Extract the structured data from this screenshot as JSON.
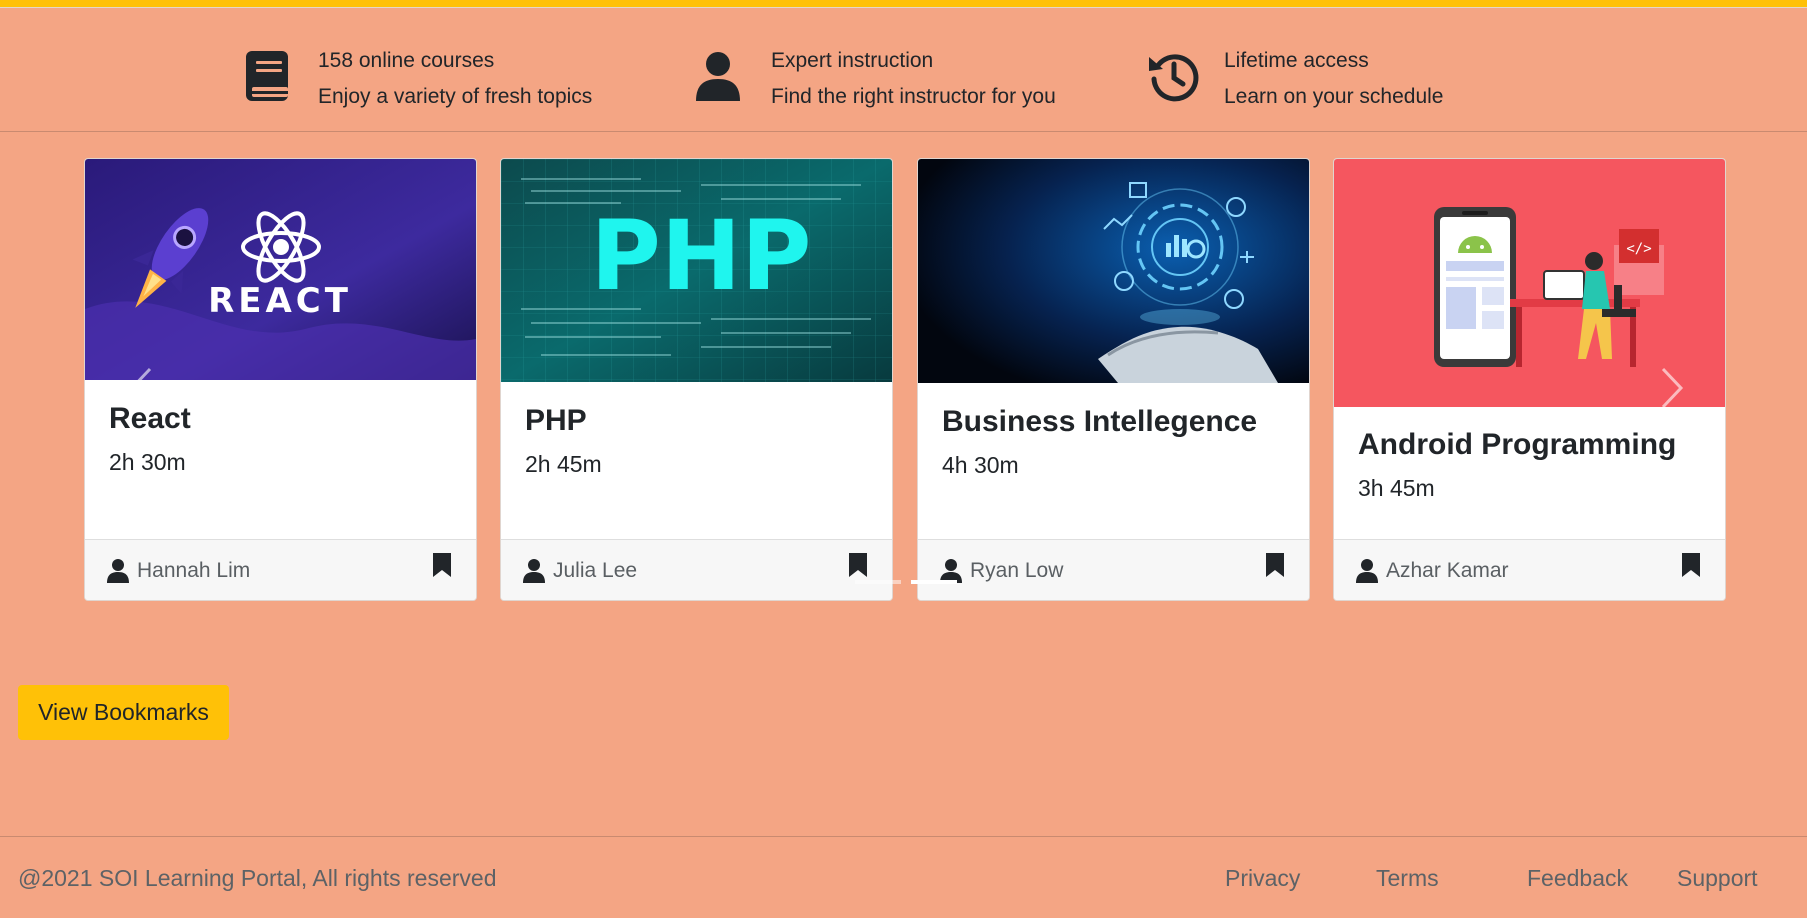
{
  "features": [
    {
      "icon": "book-icon",
      "title": "158 online courses",
      "subtitle": "Enjoy a variety of fresh topics"
    },
    {
      "icon": "user-icon",
      "title": "Expert instruction",
      "subtitle": "Find the right instructor for you"
    },
    {
      "icon": "history-icon",
      "title": "Lifetime access",
      "subtitle": "Learn on your schedule"
    }
  ],
  "courses": [
    {
      "title": "React",
      "duration": "2h 30m",
      "author": "Hannah Lim",
      "image_text": "REACT"
    },
    {
      "title": "PHP",
      "duration": "2h 45m",
      "author": "Julia Lee",
      "image_text": "PHP"
    },
    {
      "title": "Business Intellegence",
      "duration": "4h 30m",
      "author": "Ryan Low"
    },
    {
      "title": "Android Programming",
      "duration": "3h 45m",
      "author": "Azhar Kamar"
    }
  ],
  "actions": {
    "view_bookmarks": "View Bookmarks"
  },
  "footer": {
    "copyright": "@2021 SOI Learning Portal, All rights reserved",
    "links": [
      "Privacy",
      "Terms",
      "Feedback",
      "Support"
    ]
  },
  "colors": {
    "page_bg": "#f4a584",
    "accent": "#ffc107",
    "card_footer": "#f7f7f7"
  }
}
